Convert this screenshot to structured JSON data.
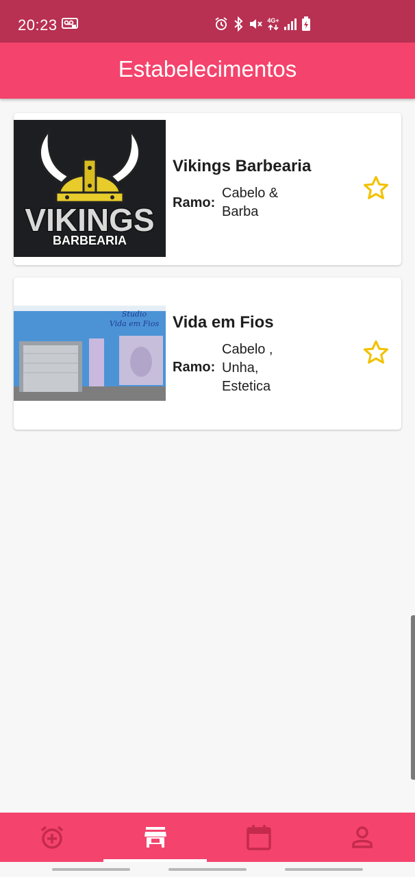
{
  "status_bar": {
    "time": "20:23",
    "network": "4G+",
    "icons": [
      "voicemail-icon",
      "alarm-icon",
      "bluetooth-icon",
      "mute-icon",
      "network-data-icon",
      "signal-icon",
      "battery-charging-icon"
    ]
  },
  "app_bar": {
    "title": "Estabelecimentos"
  },
  "establishments": [
    {
      "name": "Vikings Barbearia",
      "ramo_label": "Ramo:",
      "ramo_lines": [
        "Cabelo &",
        "Barba"
      ],
      "logo_text_1": "VIKINGS",
      "logo_text_2": "BARBEARIA",
      "favorite": false
    },
    {
      "name": "Vida em Fios",
      "ramo_label": "Ramo:",
      "ramo_lines": [
        "Cabelo ,",
        "Unha,",
        "Estetica"
      ],
      "sign_text_1": "Studio",
      "sign_text_2": "Vida em Fios",
      "favorite": false
    }
  ],
  "bottom_nav": {
    "items": [
      {
        "icon": "add-alarm-icon",
        "active": false
      },
      {
        "icon": "store-icon",
        "active": true
      },
      {
        "icon": "calendar-icon",
        "active": false
      },
      {
        "icon": "person-icon",
        "active": false
      }
    ]
  },
  "colors": {
    "status_bar": "#b83052",
    "primary": "#f4436c",
    "star": "#f2c200",
    "nav_inactive": "#c42a4c"
  }
}
